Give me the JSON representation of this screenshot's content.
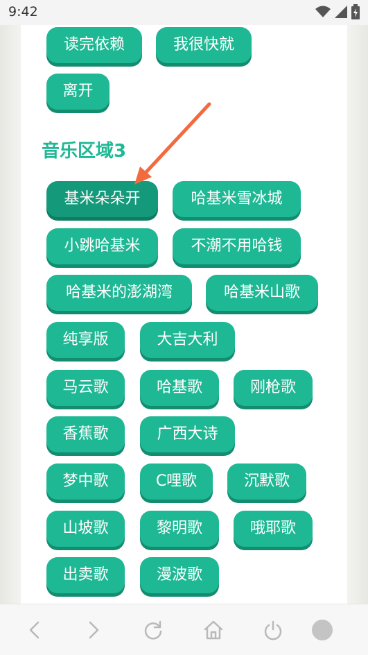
{
  "status_bar": {
    "time": "9:42",
    "icons": [
      "wifi-icon",
      "signal-icon",
      "battery-icon"
    ]
  },
  "section": {
    "title": "音乐区域3"
  },
  "prev_tags": [
    "读完依赖",
    "我很快就",
    "离开"
  ],
  "tags": [
    "基米朵朵开",
    "哈基米雪冰城",
    "小跳哈基米",
    "不潮不用哈钱",
    "哈基米的澎湖湾",
    "哈基米山歌",
    "纯享版",
    "大吉大利",
    "马云歌",
    "哈基歌",
    "刚枪歌",
    "香蕉歌",
    "广西大诗",
    "梦中歌",
    "C哩歌",
    "沉默歌",
    "山坡歌",
    "黎明歌",
    "哦耶歌",
    "出卖歌",
    "漫波歌"
  ],
  "active_tag": "基米朵朵开",
  "nav": [
    "back-icon",
    "forward-icon",
    "reload-icon",
    "home-icon",
    "power-icon",
    "circle-icon"
  ],
  "colors": {
    "tag_bg": "#1fb894",
    "tag_shadow": "#138d70",
    "title": "#1fb894",
    "arrow": "#f26a3d"
  }
}
